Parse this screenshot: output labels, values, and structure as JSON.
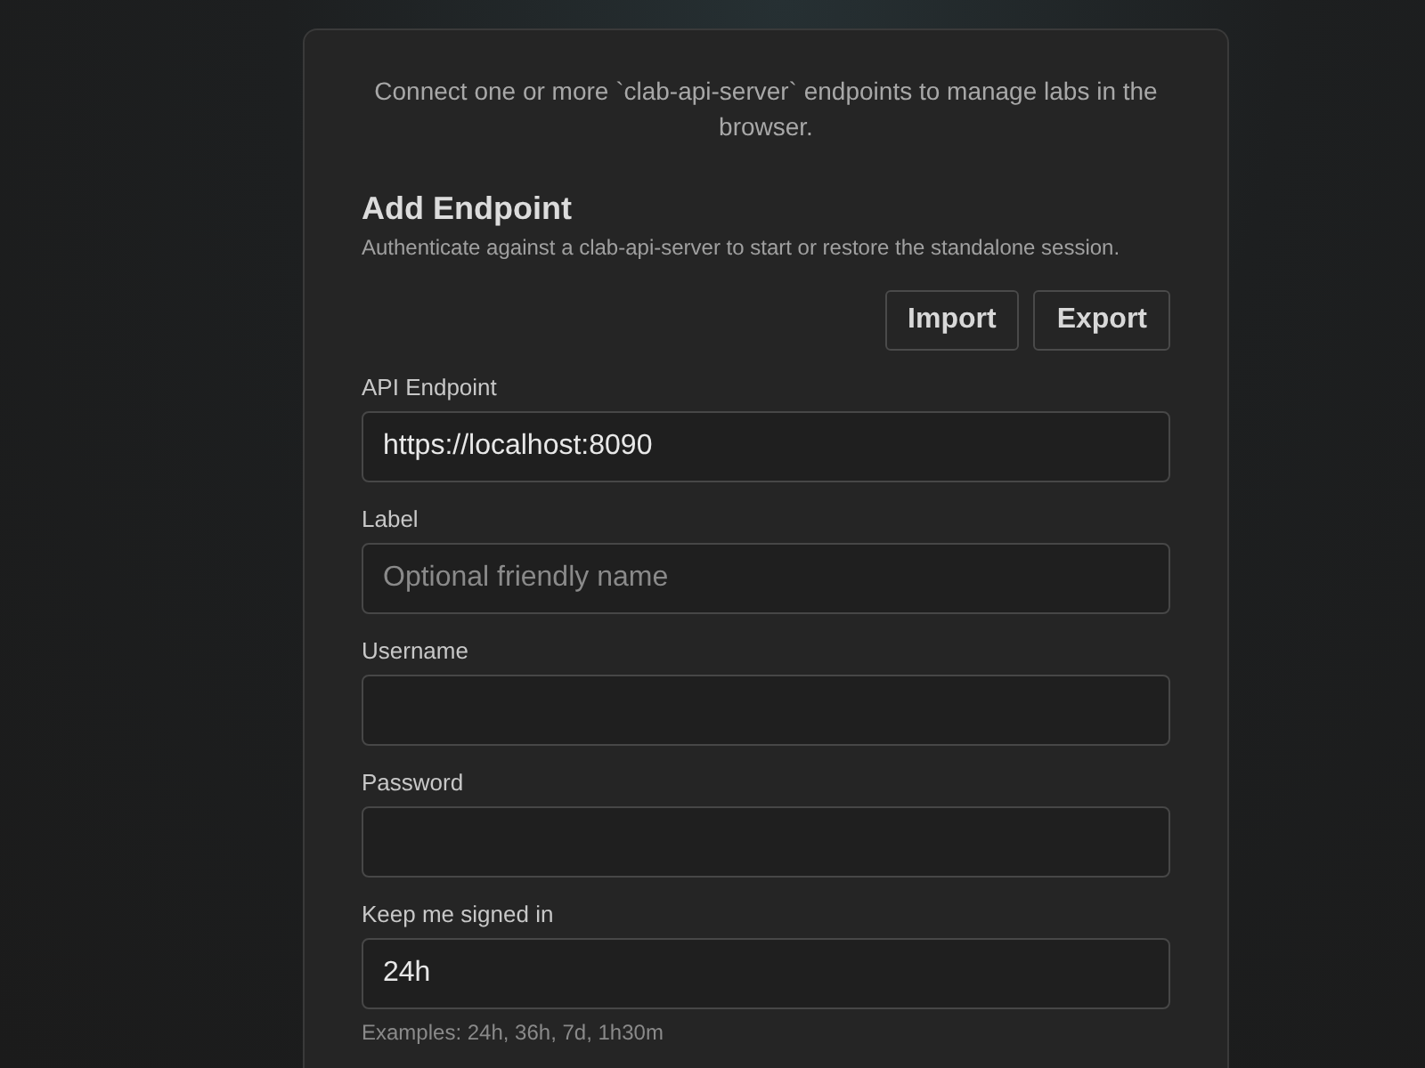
{
  "intro": "Connect one or more `clab-api-server` endpoints to manage labs in the browser.",
  "title": "Add Endpoint",
  "subtitle": "Authenticate against a clab-api-server to start or restore the standalone session.",
  "buttons": [
    "Import",
    "Export"
  ],
  "fields": [
    {
      "label": "API Endpoint",
      "value": "https://localhost:8090"
    },
    {
      "label": "Label",
      "placeholder": "Optional friendly name"
    },
    {
      "label": "Username"
    },
    {
      "label": "Password"
    },
    {
      "label": "Keep me signed in",
      "value": "24h"
    }
  ],
  "hint": "Examples: 24h, 36h, 7d, 1h30m"
}
